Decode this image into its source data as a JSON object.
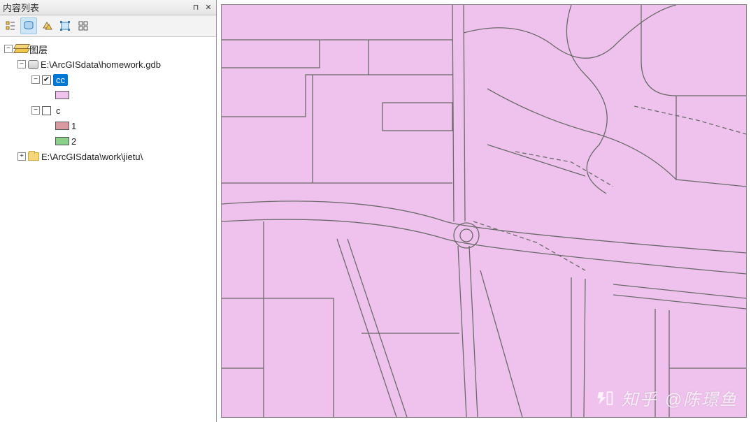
{
  "panel": {
    "title": "内容列表",
    "pin_tooltip": "固定",
    "close_tooltip": "关闭"
  },
  "toolbar": {
    "buttons": [
      "list-by-drawing-order",
      "list-by-source",
      "list-by-visibility",
      "list-by-selection",
      "options"
    ]
  },
  "tree": {
    "root": {
      "label": "图层",
      "expanded": true
    },
    "gdb": {
      "label": "E:\\ArcGISdata\\homework.gdb",
      "expanded": true,
      "layers": [
        {
          "name": "cc",
          "checked": true,
          "selected": true,
          "expanded": true,
          "symbols": [
            {
              "color": "#efc2ed",
              "label": ""
            }
          ]
        },
        {
          "name": "c",
          "checked": false,
          "selected": false,
          "expanded": true,
          "symbols": [
            {
              "color": "#d89aa0",
              "label": "1"
            },
            {
              "color": "#8ad08a",
              "label": "2"
            }
          ]
        }
      ]
    },
    "folder": {
      "label": "E:\\ArcGISdata\\work\\jietu\\",
      "expanded": false
    }
  },
  "colors": {
    "map_fill": "#efc2ed",
    "road_stroke": "#5a5a5a"
  },
  "watermark": {
    "site": "知乎",
    "author": "@陈璟鱼"
  }
}
